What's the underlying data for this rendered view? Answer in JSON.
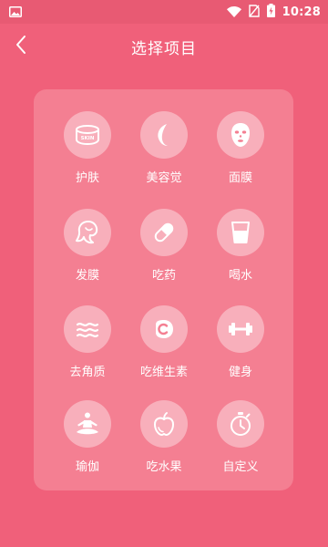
{
  "status": {
    "time": "10:28",
    "icons": [
      "image-icon",
      "wifi-icon",
      "no-sim-icon",
      "battery-charging-icon"
    ]
  },
  "header": {
    "title": "选择项目",
    "back_icon": "chevron-left-icon"
  },
  "colors": {
    "background": "#f0607a",
    "status_bar": "#e85a73",
    "panel": "#f47f92",
    "icon_circle": "rgba(255,255,255,0.38)",
    "text": "#ffffff"
  },
  "items": [
    {
      "label": "护肤",
      "icon": "skin-cream-icon"
    },
    {
      "label": "美容觉",
      "icon": "moon-icon"
    },
    {
      "label": "面膜",
      "icon": "face-mask-icon"
    },
    {
      "label": "发膜",
      "icon": "hair-icon"
    },
    {
      "label": "吃药",
      "icon": "pill-icon"
    },
    {
      "label": "喝水",
      "icon": "water-glass-icon"
    },
    {
      "label": "去角质",
      "icon": "exfoliate-waves-icon"
    },
    {
      "label": "吃维生素",
      "icon": "vitamin-c-icon"
    },
    {
      "label": "健身",
      "icon": "dumbbell-icon"
    },
    {
      "label": "瑜伽",
      "icon": "yoga-icon"
    },
    {
      "label": "吃水果",
      "icon": "apple-icon"
    },
    {
      "label": "自定义",
      "icon": "stopwatch-icon"
    }
  ]
}
